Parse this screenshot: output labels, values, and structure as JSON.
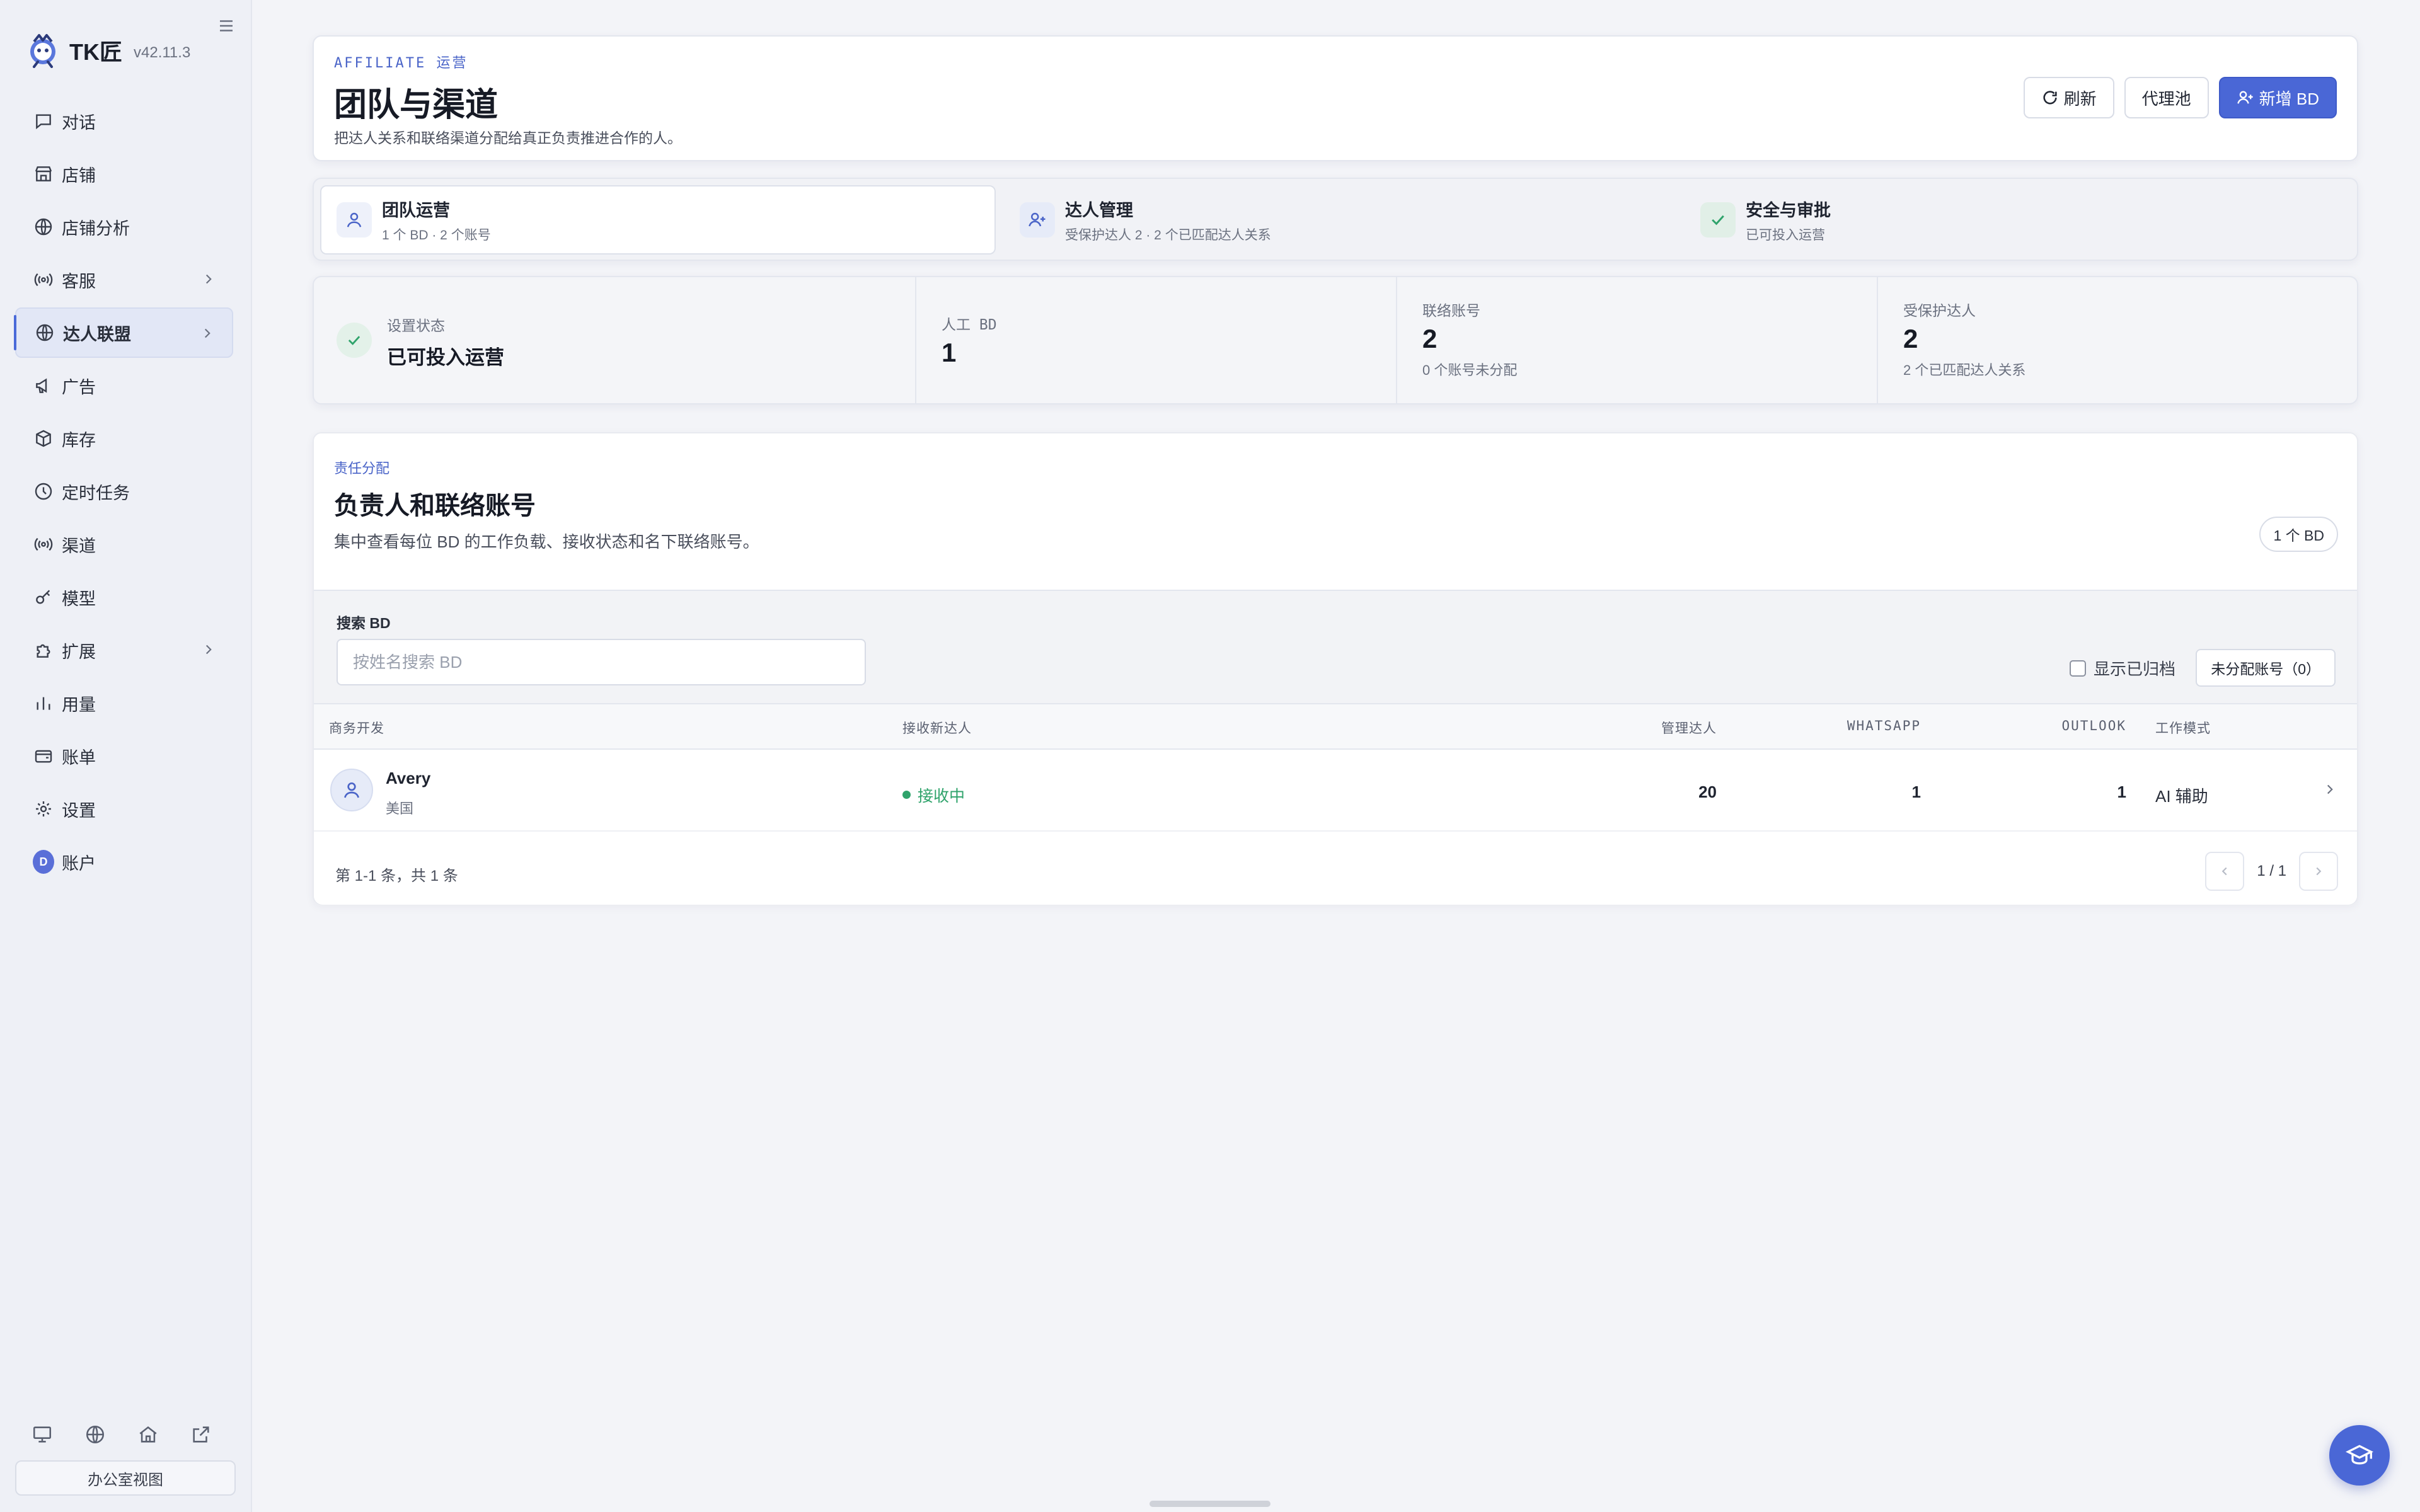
{
  "app": {
    "name": "TK匠",
    "version": "v42.11.3"
  },
  "sidebar": {
    "items": [
      {
        "label": "对话",
        "icon": "chat-icon"
      },
      {
        "label": "店铺",
        "icon": "store-icon"
      },
      {
        "label": "店铺分析",
        "icon": "globe-icon"
      },
      {
        "label": "客服",
        "icon": "broadcast-icon"
      },
      {
        "label": "达人联盟",
        "icon": "globe-icon"
      },
      {
        "label": "广告",
        "icon": "megaphone-icon"
      },
      {
        "label": "库存",
        "icon": "package-icon"
      },
      {
        "label": "定时任务",
        "icon": "clock-icon"
      },
      {
        "label": "渠道",
        "icon": "broadcast-icon"
      },
      {
        "label": "模型",
        "icon": "key-icon"
      },
      {
        "label": "扩展",
        "icon": "puzzle-icon"
      },
      {
        "label": "用量",
        "icon": "bar-chart-icon"
      },
      {
        "label": "账单",
        "icon": "wallet-icon"
      },
      {
        "label": "设置",
        "icon": "gear-icon"
      },
      {
        "label": "账户",
        "icon": "avatar-icon",
        "avatar_letter": "D"
      }
    ],
    "active": "达人联盟",
    "office_view": "办公室视图"
  },
  "header": {
    "eyebrow": "AFFILIATE 运营",
    "title": "团队与渠道",
    "description": "把达人关系和联络渠道分配给真正负责推进合作的人。",
    "refresh_label": "刷新",
    "proxy_pool_label": "代理池",
    "add_bd_label": "新增 BD"
  },
  "tabs": [
    {
      "title": "团队运营",
      "subtitle": "1 个 BD · 2 个账号"
    },
    {
      "title": "达人管理",
      "subtitle": "受保护达人 2 · 2 个已匹配达人关系"
    },
    {
      "title": "安全与审批",
      "subtitle": "已可投入运营"
    }
  ],
  "stats": {
    "setup": {
      "label": "设置状态",
      "value": "已可投入运营"
    },
    "manual_bd": {
      "label": "人工 BD",
      "value": "1"
    },
    "contact_accounts": {
      "label": "联络账号",
      "value": "2",
      "sub": "0 个账号未分配"
    },
    "protected": {
      "label": "受保护达人",
      "value": "2",
      "sub": "2 个已匹配达人关系"
    }
  },
  "section": {
    "eyebrow": "责任分配",
    "title": "负责人和联络账号",
    "description": "集中查看每位 BD 的工作负载、接收状态和名下联络账号。",
    "count_badge": "1 个 BD",
    "search_label": "搜索 BD",
    "search_placeholder": "按姓名搜索 BD",
    "search_value": "",
    "show_archived_label": "显示已归档",
    "show_archived_checked": false,
    "unassigned_label": "未分配账号（0）"
  },
  "table": {
    "columns": [
      "商务开发",
      "接收新达人",
      "管理达人",
      "WHATSAPP",
      "OUTLOOK",
      "工作模式"
    ],
    "rows": [
      {
        "name": "Avery",
        "region": "美国",
        "status": "接收中",
        "managed": "20",
        "whatsapp": "1",
        "outlook": "1",
        "mode": "AI 辅助"
      }
    ]
  },
  "pagination": {
    "summary": "第 1-1 条，共 1 条",
    "page": "1 / 1"
  },
  "colors": {
    "accent": "#4a67d6",
    "success": "#2fa36b",
    "sidebar_bg": "#eef0f6"
  }
}
